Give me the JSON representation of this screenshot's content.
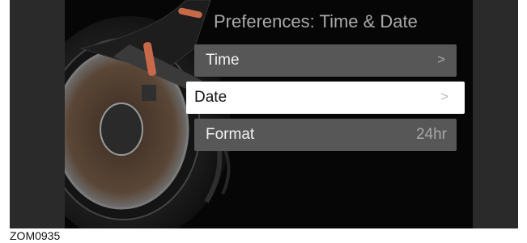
{
  "screen": {
    "title": "Preferences: Time & Date",
    "items": [
      {
        "label": "Time",
        "chevron": ">",
        "selected": false
      },
      {
        "label": "Date",
        "chevron": ">",
        "selected": true
      },
      {
        "label": "Format",
        "value": "24hr",
        "selected": false
      }
    ]
  },
  "figure_code": "ZOM0935",
  "colors": {
    "background": "#060606",
    "row": "#575757",
    "row_selected": "#ffffff",
    "title_text": "#a9a9a9",
    "accent": "#c8694a"
  }
}
